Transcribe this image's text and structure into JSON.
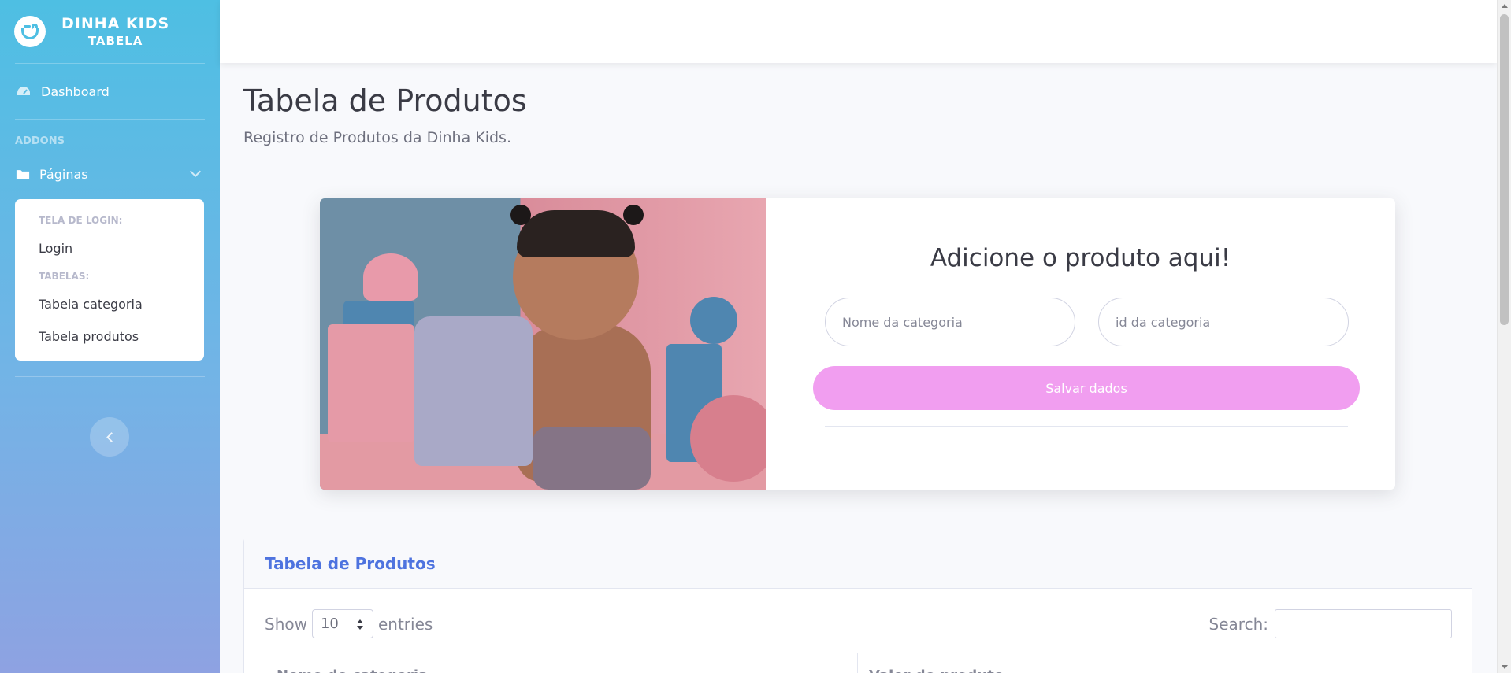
{
  "sidebar": {
    "brand": {
      "line1": "DINHA KIDS",
      "line2": "TABELA"
    },
    "dashboard_label": "Dashboard",
    "heading_addons": "ADDONS",
    "pages_label": "Páginas",
    "submenu": {
      "heading_login": "TELA DE LOGIN:",
      "login_label": "Login",
      "heading_tables": "TABELAS:",
      "table_category_label": "Tabela categoria",
      "table_products_label": "Tabela produtos"
    }
  },
  "main": {
    "title": "Tabela de Produtos",
    "subtitle": "Registro de Produtos da Dinha Kids.",
    "form": {
      "title": "Adicione o produto aqui!",
      "name_placeholder": "Nome da categoria",
      "id_placeholder": "id da categoria",
      "save_label": "Salvar dados"
    },
    "table": {
      "header": "Tabela de Produtos",
      "show_label": "Show",
      "entries_value": "10",
      "entries_label": "entries",
      "search_label": "Search:",
      "columns": [
        "Nome do categoria",
        "Valor do produto"
      ]
    }
  },
  "colors": {
    "sidebar_top": "#4ebfe3",
    "sidebar_bottom": "#8ea2e2",
    "save_button": "#f19ef0",
    "table_header_text": "#4e73df"
  }
}
